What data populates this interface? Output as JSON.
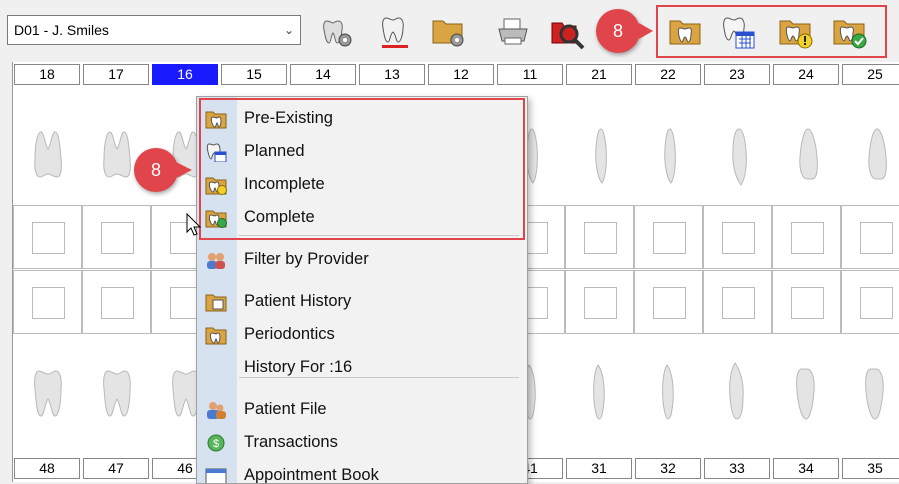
{
  "provider_select": {
    "value": "D01 - J. Smiles"
  },
  "toolbar": {
    "buttons": [
      {
        "name": "tooth-settings-icon"
      },
      {
        "name": "tooth-chart-icon"
      },
      {
        "name": "folder-settings-icon"
      },
      {
        "name": "printer-icon"
      },
      {
        "name": "search-icon"
      },
      {
        "name": "pre-existing-icon"
      },
      {
        "name": "planned-icon"
      },
      {
        "name": "incomplete-icon"
      },
      {
        "name": "complete-icon"
      }
    ]
  },
  "callouts": {
    "top": "8",
    "menu": "8"
  },
  "upper_teeth": [
    "18",
    "17",
    "16",
    "15",
    "14",
    "13",
    "12",
    "11",
    "21",
    "22",
    "23",
    "24",
    "25"
  ],
  "lower_teeth": [
    "48",
    "47",
    "46",
    "",
    "",
    "",
    "",
    "41",
    "31",
    "32",
    "33",
    "34",
    "35"
  ],
  "selected_tooth": "16",
  "context_menu": {
    "items": [
      {
        "label": "Pre-Existing",
        "icon": "pre-existing-icon"
      },
      {
        "label": "Planned",
        "icon": "planned-icon"
      },
      {
        "label": "Incomplete",
        "icon": "incomplete-icon"
      },
      {
        "label": "Complete",
        "icon": "complete-icon"
      },
      {
        "label": "Filter by Provider",
        "icon": "filter-provider-icon"
      },
      {
        "label": "Patient History",
        "icon": "patient-history-icon"
      },
      {
        "label": "Periodontics",
        "icon": "periodontics-icon"
      },
      {
        "label": "History For :16",
        "icon": ""
      },
      {
        "label": "Patient File",
        "icon": "patient-file-icon"
      },
      {
        "label": "Transactions",
        "icon": "transactions-icon"
      },
      {
        "label": "Appointment Book",
        "icon": "appointment-book-icon"
      }
    ]
  },
  "colors": {
    "callout": "#e0454b",
    "selected": "#1a1aff",
    "gutter": "#d7e2f0"
  }
}
